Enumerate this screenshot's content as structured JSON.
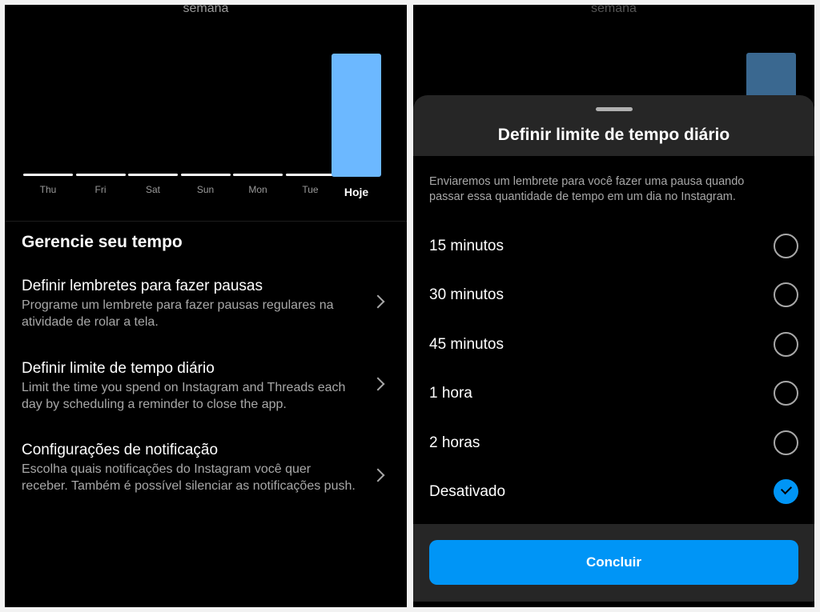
{
  "left": {
    "chart_header": "semana",
    "chart_data": {
      "type": "bar",
      "categories": [
        "Thu",
        "Fri",
        "Sat",
        "Sun",
        "Mon",
        "Tue",
        "Hoje"
      ],
      "values": [
        0,
        0,
        0,
        0,
        0,
        0,
        1
      ],
      "highlight": "Hoje",
      "bar_color": "#6cb8ff",
      "empty_color": "#ffffff"
    },
    "section_title": "Gerencie seu tempo",
    "items": [
      {
        "title": "Definir lembretes para fazer pausas",
        "desc": "Programe um lembrete para fazer pausas regulares na atividade de rolar a tela.",
        "icon": "chevron-right-icon"
      },
      {
        "title": "Definir limite de tempo diário",
        "desc": "Limit the time you spend on Instagram and Threads each day by scheduling a reminder to close the app.",
        "icon": "chevron-right-icon"
      },
      {
        "title": "Configurações de notificação",
        "desc": "Escolha quais notificações do Instagram você quer receber. Também é possível silenciar as notificações push.",
        "icon": "chevron-right-icon"
      }
    ]
  },
  "right": {
    "chart_header": "semana",
    "sheet": {
      "title": "Definir limite de tempo diário",
      "description": "Enviaremos um lembrete para você fazer uma pausa quando passar essa quantidade de tempo em um dia no Instagram.",
      "options": [
        {
          "label": "15 minutos",
          "selected": false
        },
        {
          "label": "30 minutos",
          "selected": false
        },
        {
          "label": "45 minutos",
          "selected": false
        },
        {
          "label": "1 hora",
          "selected": false
        },
        {
          "label": "2 horas",
          "selected": false
        },
        {
          "label": "Desativado",
          "selected": true
        }
      ],
      "button": "Concluir",
      "accent": "#0095f6"
    }
  }
}
